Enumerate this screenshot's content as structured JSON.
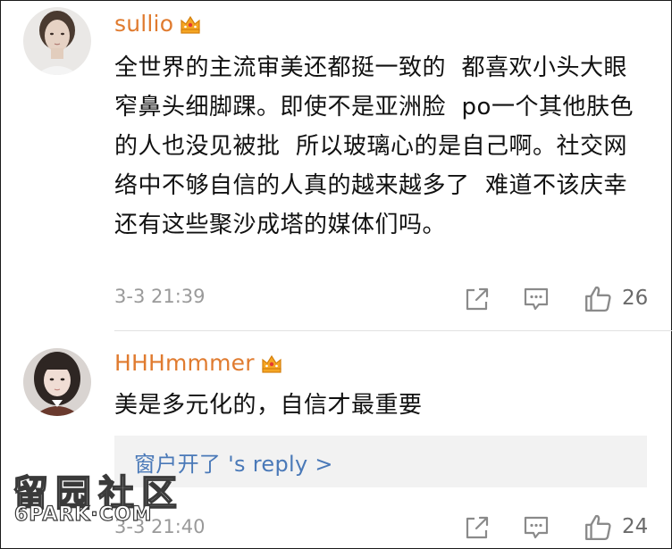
{
  "comments": [
    {
      "username": "sullio",
      "text": "全世界的主流审美还都挺一致的  都喜欢小头大眼窄鼻头细脚踝。即使不是亚洲脸  po一个其他肤色的人也没见被批  所以玻璃心的是自己啊。社交网络中不够自信的人真的越来越多了  难道不该庆幸还有这些聚沙成塔的媒体们吗。",
      "timestamp": "3-3 21:39",
      "likes": "26"
    },
    {
      "username": "HHHmmmer",
      "text": "美是多元化的，自信才最重要",
      "reply_link": "窗户开了  's reply >",
      "timestamp": "3-3 21:40",
      "likes": "24"
    }
  ],
  "icons": {
    "badge": "crown-vip-icon",
    "share": "share-icon",
    "comment": "comment-icon",
    "like": "thumbs-up-icon"
  },
  "colors": {
    "username": "#e07b2f",
    "reply_link": "#4a79b8",
    "timestamp": "#9a9a9a",
    "text": "#111111"
  },
  "watermark": {
    "text_cn": "留园社区",
    "text_en": "6PARK·COM"
  }
}
